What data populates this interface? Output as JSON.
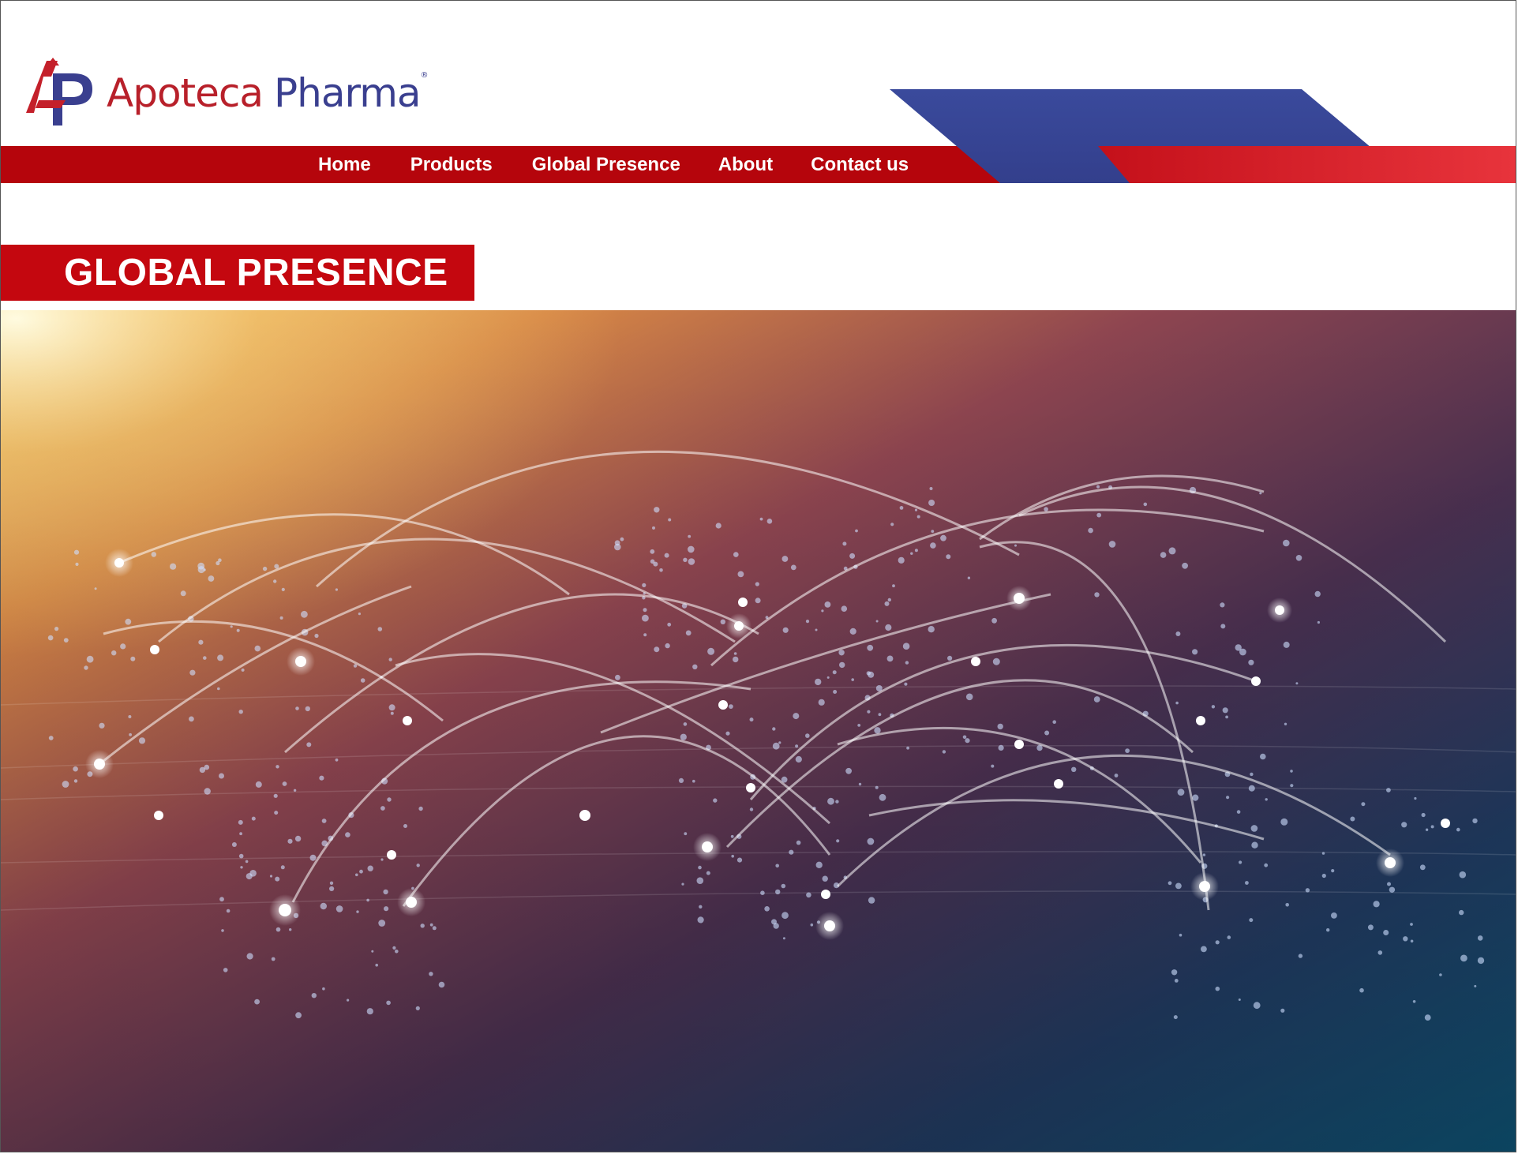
{
  "brand": {
    "name_part1": "Apoteca",
    "name_part2": "Pharma",
    "registered": "®"
  },
  "nav": {
    "items": [
      {
        "label": "Home"
      },
      {
        "label": "Products"
      },
      {
        "label": "Global Presence"
      },
      {
        "label": "About"
      },
      {
        "label": "Contact us"
      }
    ]
  },
  "page": {
    "title": "GLOBAL PRESENCE"
  },
  "hero": {
    "image": "world-network-map"
  },
  "colors": {
    "brand_red": "#c4070f",
    "brand_blue": "#3a4898",
    "logo_red": "#b8202a",
    "logo_blue": "#3a3f8f"
  },
  "icons": {
    "logo": "apoteca-ap-logo-icon"
  }
}
